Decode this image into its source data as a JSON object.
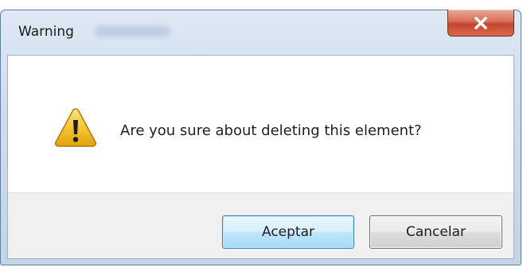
{
  "window": {
    "title": "Warning"
  },
  "icons": {
    "warning": "warning-icon",
    "close": "close-icon"
  },
  "dialog": {
    "message": "Are you sure about deleting this element?",
    "ok_label": "Aceptar",
    "cancel_label": "Cancelar"
  },
  "colors": {
    "close_button": "#c4452b",
    "warning_fill": "#f3c22f",
    "ok_button_border": "#3c7fb1"
  }
}
